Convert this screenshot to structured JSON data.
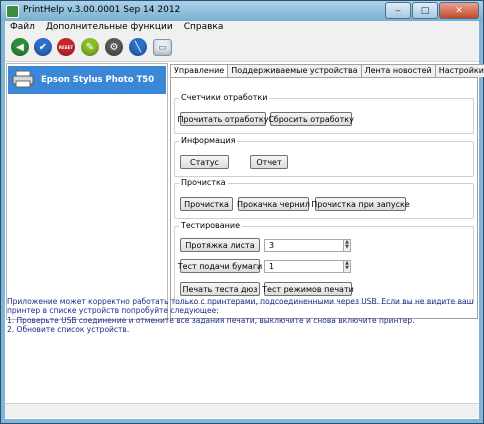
{
  "window": {
    "title": "PrintHelp v.3.00.0001 Sep 14 2012"
  },
  "menu": [
    "Файл",
    "Дополнительные функции",
    "Справка"
  ],
  "toolbar": {
    "buttons": [
      {
        "icon": "back-arrow-icon",
        "color": "#2f8f3a"
      },
      {
        "icon": "check-icon",
        "color": "#2a6fc9"
      },
      {
        "icon": "reset-icon",
        "color": "#c8282a",
        "label": "RESET"
      },
      {
        "icon": "pencil-icon",
        "color": "#8bbf2a"
      },
      {
        "icon": "gear-icon",
        "color": "#5a5a5a"
      },
      {
        "icon": "ink-icon",
        "color": "#2a6fc9"
      },
      {
        "icon": "document-icon",
        "color": "#dfe8f0"
      }
    ]
  },
  "sidebar": {
    "printer": "Epson Stylus Photo T50"
  },
  "tabs": [
    "Управление",
    "Поддерживаемые устройства",
    "Лента новостей",
    "Настройки"
  ],
  "groups": {
    "counters": {
      "title": "Счетчики отработки",
      "read": "Прочитать отработку",
      "reset": "Сбросить отработку"
    },
    "info": {
      "title": "Информация",
      "status": "Статус",
      "report": "Отчет"
    },
    "cleaning": {
      "title": "Прочистка",
      "clean": "Прочистка",
      "pump": "Прокачка чернил",
      "startup": "Прочистка при запуске"
    },
    "testing": {
      "title": "Тестирование",
      "feed": "Протяжка листа",
      "feed_value": "3",
      "paper": "Тест подачи бумаги",
      "paper_value": "1",
      "nozzle": "Печать теста дюз",
      "modes": "Тест режимов печати"
    }
  },
  "info_text": [
    "Приложение может корректно работать только с принтерами, подсоединенными через USB. Если вы не видите ваш принтер в списке устройств попробуйте следующее:",
    "1. Проверьте USB соединение и отмените все задания печати, выключите и снова включите принтер.",
    "2. Обновите список устройств."
  ]
}
